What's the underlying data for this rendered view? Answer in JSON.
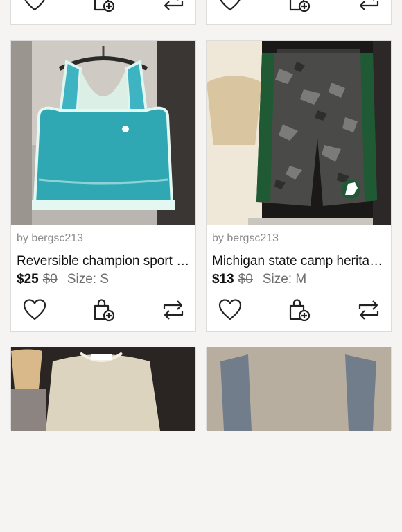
{
  "listings": [
    {
      "seller": "by bergsc213",
      "title": "Reversible champion sport bra",
      "price": "$25",
      "original_price": "$0",
      "size": "Size: S",
      "image": "teal-sports-bra-photo"
    },
    {
      "seller": "by bergsc213",
      "title": "Michigan state camp heritage shorts",
      "price": "$13",
      "original_price": "$0",
      "size": "Size: M",
      "image": "green-camo-shorts-photo"
    }
  ],
  "actions": {
    "like_icon": "heart-icon",
    "bundle_icon": "bag-plus-icon",
    "share_icon": "share-arrows-icon"
  },
  "colors": {
    "page_bg": "#f6f4f3",
    "card_bg": "#ffffff",
    "muted_text": "#8a8a8a",
    "teal": "#2fa8b4"
  }
}
